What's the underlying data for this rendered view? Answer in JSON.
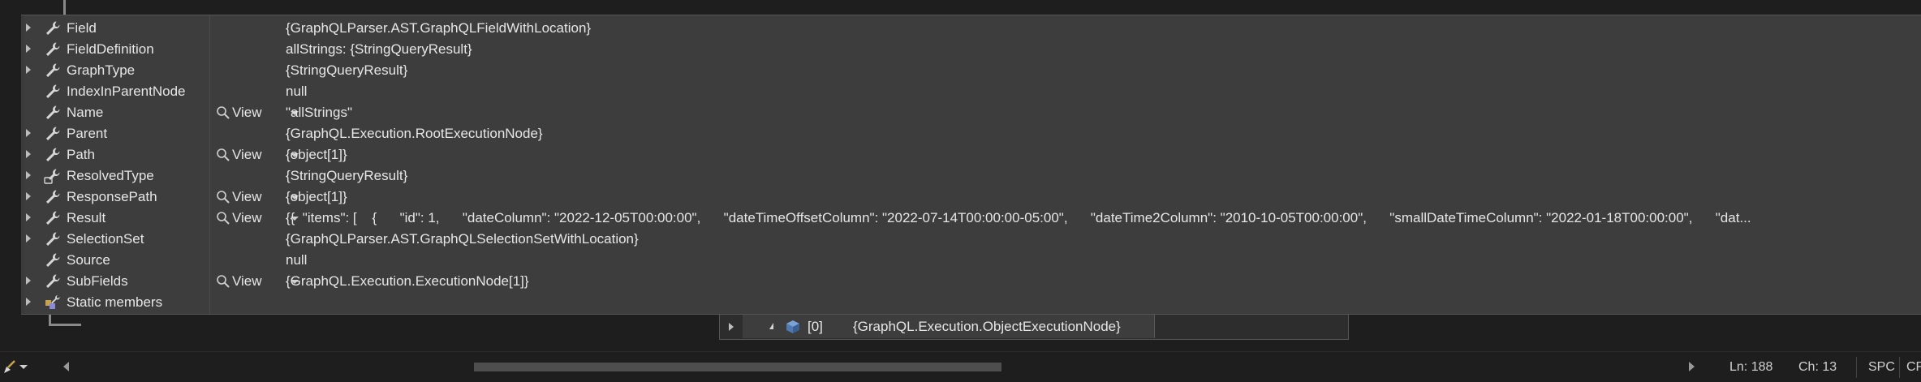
{
  "datatip": {
    "rows": [
      {
        "name": "Field",
        "value": "{GraphQLParser.AST.GraphQLFieldWithLocation}",
        "expandable": true,
        "icon": "wrench-icon",
        "view": false
      },
      {
        "name": "FieldDefinition",
        "value": "allStrings: {StringQueryResult}",
        "expandable": true,
        "icon": "wrench-icon",
        "view": false
      },
      {
        "name": "GraphType",
        "value": "{StringQueryResult}",
        "expandable": true,
        "icon": "wrench-icon",
        "view": false
      },
      {
        "name": "IndexInParentNode",
        "value": "null",
        "expandable": false,
        "icon": "wrench-icon",
        "view": false
      },
      {
        "name": "Name",
        "value": "\"allStrings\"",
        "expandable": false,
        "icon": "wrench-icon",
        "view": true
      },
      {
        "name": "Parent",
        "value": "{GraphQL.Execution.RootExecutionNode}",
        "expandable": true,
        "icon": "wrench-icon",
        "view": false
      },
      {
        "name": "Path",
        "value": "{object[1]}",
        "expandable": true,
        "icon": "wrench-icon",
        "view": true
      },
      {
        "name": "ResolvedType",
        "value": "{StringQueryResult}",
        "expandable": true,
        "icon": "property-link-icon",
        "view": false
      },
      {
        "name": "ResponsePath",
        "value": "{object[1]}",
        "expandable": true,
        "icon": "wrench-icon",
        "view": true
      },
      {
        "name": "Result",
        "value": "{{  \"items\": [    {      \"id\": 1,      \"dateColumn\": \"2022-12-05T00:00:00\",      \"dateTimeOffsetColumn\": \"2022-07-14T00:00:00-05:00\",      \"dateTime2Column\": \"2010-10-05T00:00:00\",      \"smallDateTimeColumn\": \"2022-01-18T00:00:00\",      \"dat...",
        "expandable": true,
        "icon": "wrench-icon",
        "view": true
      },
      {
        "name": "SelectionSet",
        "value": "{GraphQLParser.AST.GraphQLSelectionSetWithLocation}",
        "expandable": true,
        "icon": "wrench-icon",
        "view": false
      },
      {
        "name": "Source",
        "value": "null",
        "expandable": false,
        "icon": "wrench-icon",
        "view": false
      },
      {
        "name": "SubFields",
        "value": "{GraphQL.Execution.ExecutionNode[1]}",
        "expandable": true,
        "icon": "wrench-icon",
        "view": true
      },
      {
        "name": "Static members",
        "value": "",
        "expandable": true,
        "icon": "static-members-icon",
        "view": false
      }
    ],
    "view_label": "View"
  },
  "subtip": {
    "name": "[0]",
    "value": "{GraphQL.Execution.ObjectExecutionNode}",
    "icon": "object-cube-icon"
  },
  "statusbar": {
    "line": "Ln: 188",
    "col": "Ch: 13",
    "whitespace": "SPC",
    "eol": "CR"
  },
  "colors": {
    "tooltip_bg": "#3d3d3d",
    "editor_bg": "#1e1e1e",
    "text": "#e6e6e6"
  }
}
